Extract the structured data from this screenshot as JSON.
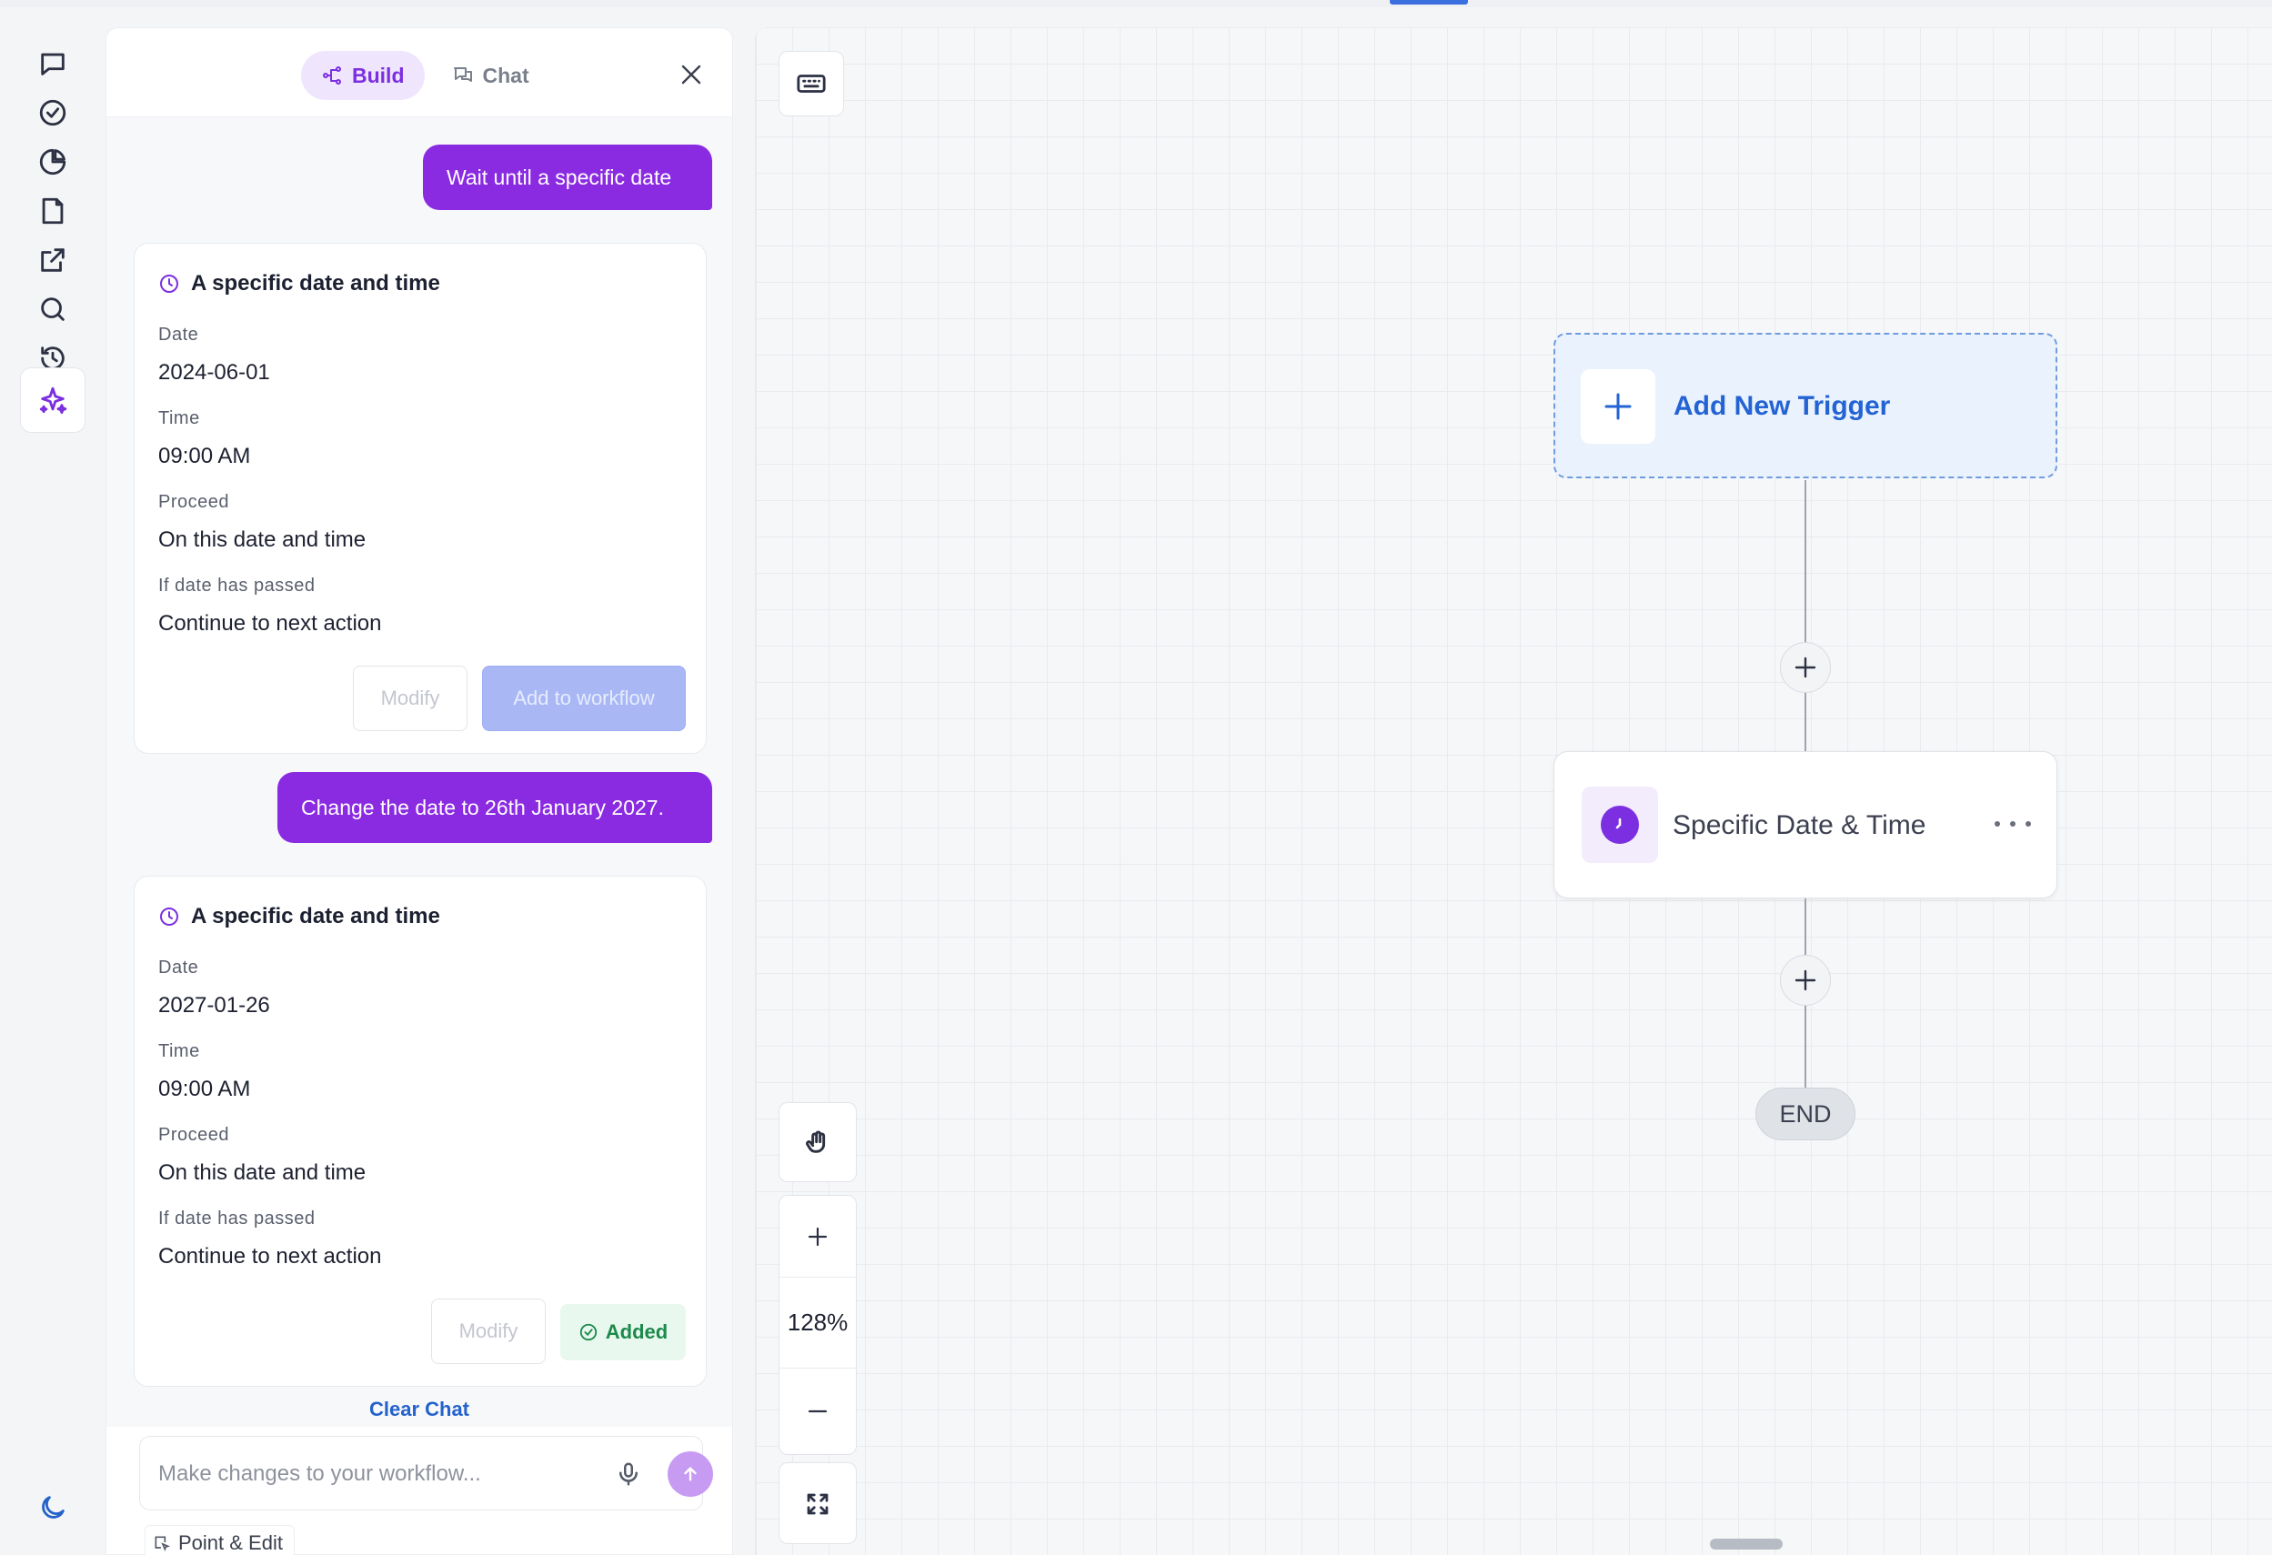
{
  "panel": {
    "tabs": [
      {
        "label": "Build",
        "icon": "workflow-icon",
        "active": true
      },
      {
        "label": "Chat",
        "icon": "chat-bubbles-icon",
        "active": false
      }
    ],
    "messages": {
      "user_1": "Wait until a specific date",
      "user_2": "Change the date to 26th January 2027."
    },
    "cards": [
      {
        "title": "A specific date and time",
        "fields": [
          {
            "label": "Date",
            "value": "2024-06-01"
          },
          {
            "label": "Time",
            "value": "09:00 AM"
          },
          {
            "label": "Proceed",
            "value": "On this date and time"
          },
          {
            "label": "If date has passed",
            "value": "Continue to next action"
          }
        ],
        "modify_label": "Modify",
        "action_label": "Add to workflow"
      },
      {
        "title": "A specific date and time",
        "fields": [
          {
            "label": "Date",
            "value": "2027-01-26"
          },
          {
            "label": "Time",
            "value": "09:00 AM"
          },
          {
            "label": "Proceed",
            "value": "On this date and time"
          },
          {
            "label": "If date has passed",
            "value": "Continue to next action"
          }
        ],
        "modify_label": "Modify",
        "action_label": "Added"
      }
    ],
    "clear_chat": "Clear Chat",
    "composer": {
      "placeholder": "Make changes to your workflow..."
    },
    "point_edit": "Point & Edit"
  },
  "canvas": {
    "trigger_label": "Add New Trigger",
    "action_label": "Specific Date & Time",
    "end_label": "END",
    "zoom": "128%"
  },
  "colors": {
    "accent_purple": "#8a2be2",
    "link_blue": "#2463d4",
    "added_green": "#1b8a4b"
  }
}
